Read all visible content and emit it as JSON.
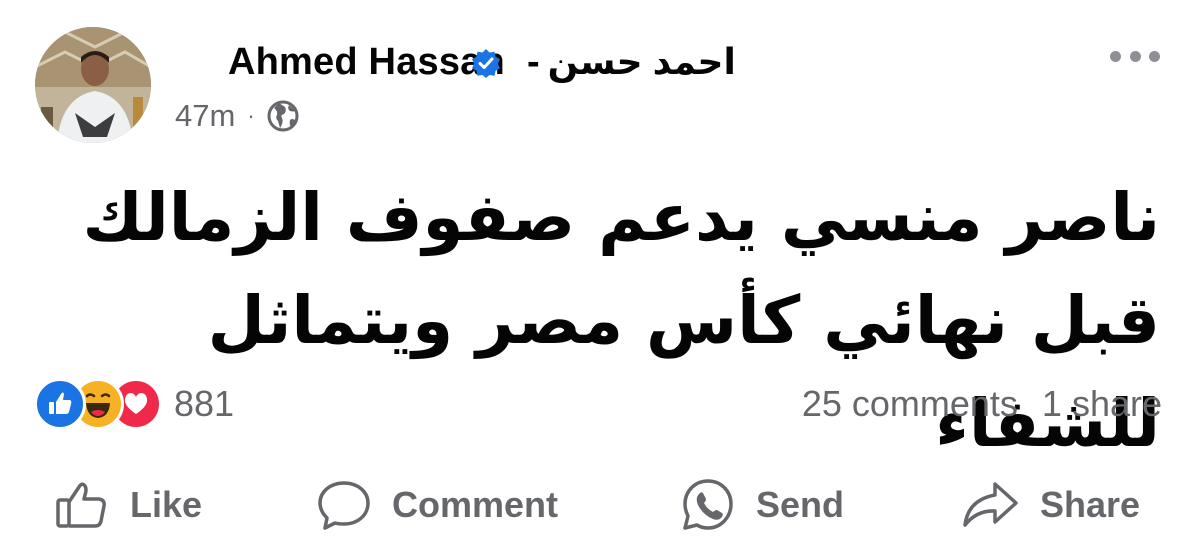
{
  "post": {
    "author": {
      "name": "Ahmed Hassan",
      "separator": "-",
      "name_arabic": "احمد حسن",
      "verified": true
    },
    "time": "47m",
    "dot": "·",
    "privacy_icon": "globe-icon",
    "more_icon": "more-dots-icon",
    "text_lines": [
      "ناصر منسي يدعم صفوف الزمالك",
      "قبل نهائي كأس مصر ويتماثل للشفاء"
    ]
  },
  "reactions": {
    "icons": [
      "like-reaction-icon",
      "haha-reaction-icon",
      "love-reaction-icon"
    ],
    "count": "881"
  },
  "engagement": {
    "comments": "25 comments",
    "shares": "1 share"
  },
  "actions": {
    "like": "Like",
    "comment": "Comment",
    "send": "Send",
    "share": "Share"
  },
  "colors": {
    "facebook_blue": "#1b74e4",
    "secondary_text": "#65676b",
    "primary_text": "#050505",
    "haha_yellow": "#f7b125",
    "love_red": "#f0284a"
  }
}
